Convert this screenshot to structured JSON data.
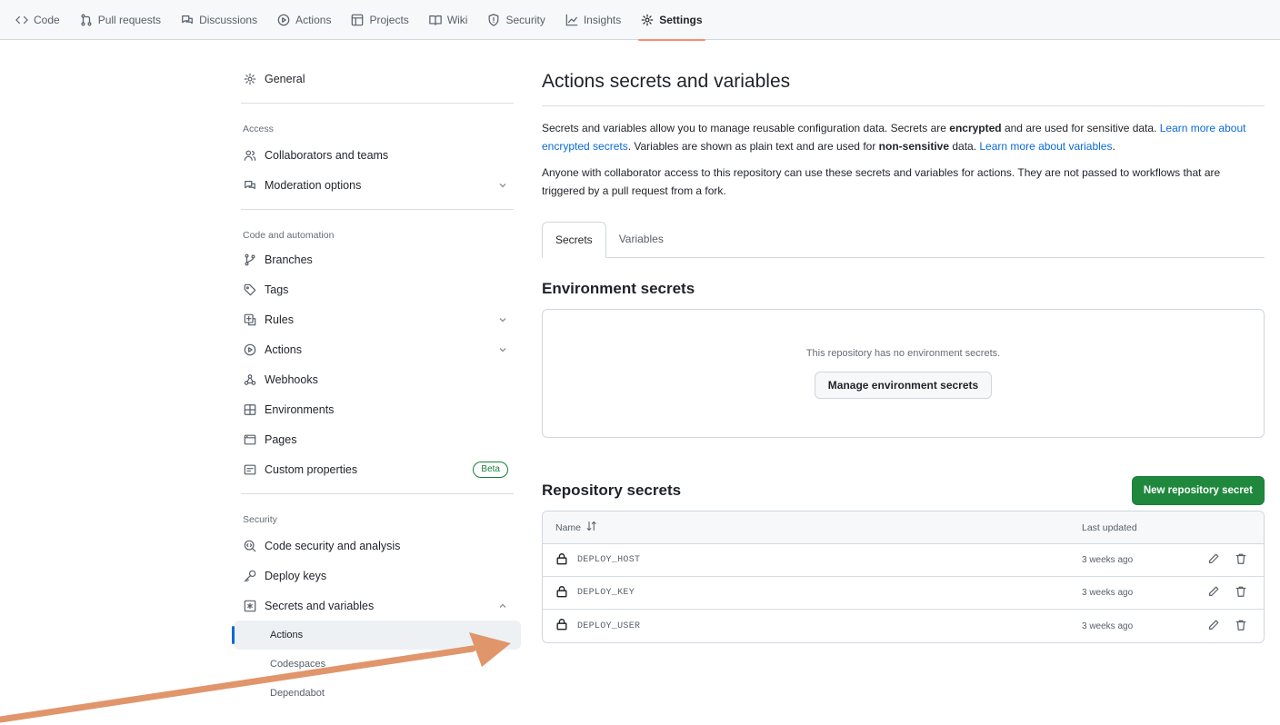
{
  "topnav": {
    "tabs": [
      {
        "label": "Code",
        "icon": "code-icon"
      },
      {
        "label": "Pull requests",
        "icon": "pull-request-icon"
      },
      {
        "label": "Discussions",
        "icon": "discussions-icon"
      },
      {
        "label": "Actions",
        "icon": "actions-icon"
      },
      {
        "label": "Projects",
        "icon": "projects-icon"
      },
      {
        "label": "Wiki",
        "icon": "wiki-icon"
      },
      {
        "label": "Security",
        "icon": "shield-icon"
      },
      {
        "label": "Insights",
        "icon": "graph-icon"
      },
      {
        "label": "Settings",
        "icon": "gear-icon",
        "active": true
      }
    ]
  },
  "sidebar": {
    "general": "General",
    "access_heading": "Access",
    "access": [
      "Collaborators and teams",
      "Moderation options"
    ],
    "code_heading": "Code and automation",
    "code": [
      "Branches",
      "Tags",
      "Rules",
      "Actions",
      "Webhooks",
      "Environments",
      "Pages",
      "Custom properties"
    ],
    "beta_label": "Beta",
    "security_heading": "Security",
    "security": [
      "Code security and analysis",
      "Deploy keys",
      "Secrets and variables"
    ],
    "secrets_sub": [
      "Actions",
      "Codespaces",
      "Dependabot"
    ]
  },
  "main": {
    "title": "Actions secrets and variables",
    "desc": {
      "p1": "Secrets and variables allow you to manage reusable configuration data. Secrets are ",
      "b1": "encrypted",
      "p2": " and are used for sensitive data. ",
      "link1": "Learn more about encrypted secrets",
      "p3": ". Variables are shown as plain text and are used for ",
      "b2": "non-sensitive",
      "p4": " data. ",
      "link2": "Learn more about variables",
      "p5": "."
    },
    "desc2": "Anyone with collaborator access to this repository can use these secrets and variables for actions. They are not passed to workflows that are triggered by a pull request from a fork.",
    "tabs": [
      "Secrets",
      "Variables"
    ],
    "env_title": "Environment secrets",
    "env_empty": "This repository has no environment secrets.",
    "env_button": "Manage environment secrets",
    "repo_title": "Repository secrets",
    "repo_button": "New repository secret",
    "table": {
      "col_name": "Name",
      "col_updated": "Last updated",
      "rows": [
        {
          "name": "DEPLOY_HOST",
          "updated": "3 weeks ago"
        },
        {
          "name": "DEPLOY_KEY",
          "updated": "3 weeks ago"
        },
        {
          "name": "DEPLOY_USER",
          "updated": "3 weeks ago"
        }
      ]
    }
  },
  "colors": {
    "accent": "#0969da",
    "primary_button": "#1f883d",
    "active_tab_underline": "#fd8c73",
    "annotation_arrow": "#e0956a"
  }
}
